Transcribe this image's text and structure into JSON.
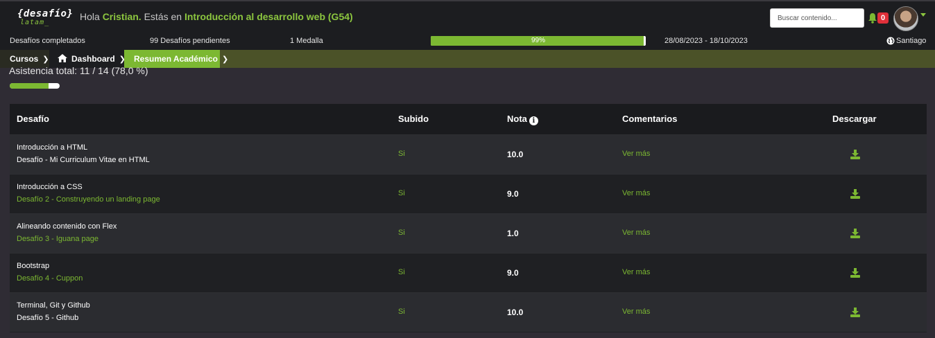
{
  "header": {
    "logo_main": "{desafío}",
    "logo_sub": "latam_",
    "greeting_prefix": "Hola",
    "user_name": "Cristian.",
    "greeting_middle": "Estás en",
    "course": "Introducción al desarrollo web (G54)",
    "search_placeholder": "Buscar contenido...",
    "notifications": "0"
  },
  "stats": {
    "completed": "Desafíos completados",
    "pending": "99 Desafíos pendientes",
    "medals": "1 Medalla",
    "progress_label": "99%",
    "progress_value": 0.99,
    "dates": "28/08/2023 - 18/10/2023",
    "location": "Santiago"
  },
  "breadcrumbs": [
    "Cursos",
    "Dashboard",
    "Resumen Académico"
  ],
  "attendance": {
    "label": "Asistencia total: 11 / 14 (78,0 %)",
    "value": 0.78
  },
  "table": {
    "headers": [
      "Desafío",
      "Subido",
      "Nota",
      "Comentarios",
      "Descargar"
    ],
    "rows": [
      {
        "title": "Introducción a HTML",
        "subtitle": "Desafío - Mi Curriculum Vitae en HTML",
        "subtitle_color": "white",
        "uploaded": "Si",
        "grade": "10.0",
        "comments": "Ver más"
      },
      {
        "title": "Introducción a CSS",
        "subtitle": "Desafío 2 - Construyendo un landing page",
        "subtitle_color": "green",
        "uploaded": "Si",
        "grade": "9.0",
        "comments": "Ver más"
      },
      {
        "title": "Alineando contenido con Flex",
        "subtitle": "Desafío 3 - Iguana page",
        "subtitle_color": "green",
        "uploaded": "Si",
        "grade": "1.0",
        "comments": "Ver más"
      },
      {
        "title": "Bootstrap",
        "subtitle": "Desafío 4 - Cuppon",
        "subtitle_color": "green",
        "uploaded": "Si",
        "grade": "9.0",
        "comments": "Ver más"
      },
      {
        "title": "Terminal, Git y Github",
        "subtitle": "Desafío 5 - Github",
        "subtitle_color": "white",
        "uploaded": "Si",
        "grade": "10.0",
        "comments": "Ver más"
      }
    ]
  },
  "colors": {
    "accent": "#7cb832",
    "background": "#2f2c34",
    "bar": "#1c1d20"
  }
}
